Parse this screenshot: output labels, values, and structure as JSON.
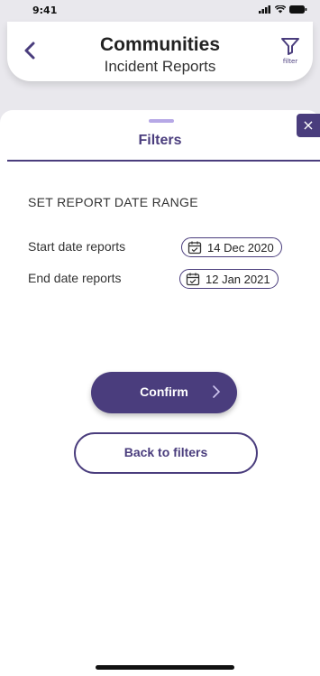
{
  "status_bar": {
    "time": "9:41"
  },
  "header": {
    "title": "Communities",
    "subtitle": "Incident Reports",
    "filter_caption": "filter"
  },
  "sheet": {
    "title": "Filters",
    "close_label": "×",
    "section_title": "SET REPORT DATE RANGE",
    "start": {
      "label": "Start date reports",
      "value": "14 Dec 2020"
    },
    "end": {
      "label": "End date reports",
      "value": "12 Jan 2021"
    },
    "confirm_label": "Confirm",
    "back_label": "Back to filters"
  },
  "colors": {
    "accent": "#4a3d7d",
    "handle": "#b6a8e6",
    "page_background": "#e9e8ed"
  },
  "icons": [
    "chevron-left-icon",
    "filter-icon",
    "close-icon",
    "calendar-icon",
    "chevron-right-icon"
  ]
}
